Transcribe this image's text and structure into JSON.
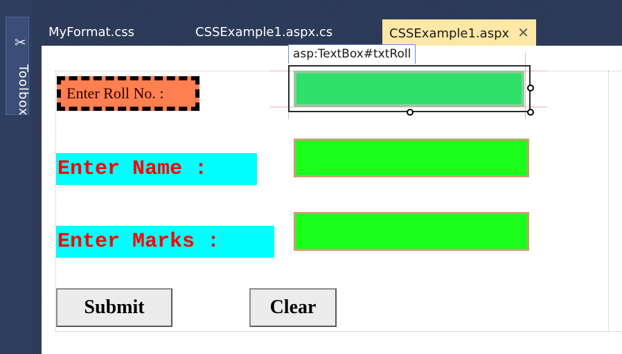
{
  "toolbox": {
    "label": "Toolbox",
    "icon": "pin-icon"
  },
  "tabs": [
    {
      "label": "MyFormat.css",
      "active": false
    },
    {
      "label": "CSSExample1.aspx.cs",
      "active": false
    },
    {
      "label": "CSSExample1.aspx",
      "active": true,
      "close": "✕"
    }
  ],
  "designer": {
    "selected_tag": "asp:TextBox#txtRoll",
    "labels": {
      "roll": "Enter Roll No. :",
      "name": "Enter Name :",
      "marks": "Enter Marks :"
    },
    "buttons": {
      "submit": "Submit",
      "clear": "Clear"
    }
  },
  "colors": {
    "roll_label_bg": "#ff7f50",
    "label_bg": "#00ffff",
    "label_text": "#ff0000",
    "textbox_bg": "#1aff1a",
    "active_tab": "#ffe8a6"
  }
}
